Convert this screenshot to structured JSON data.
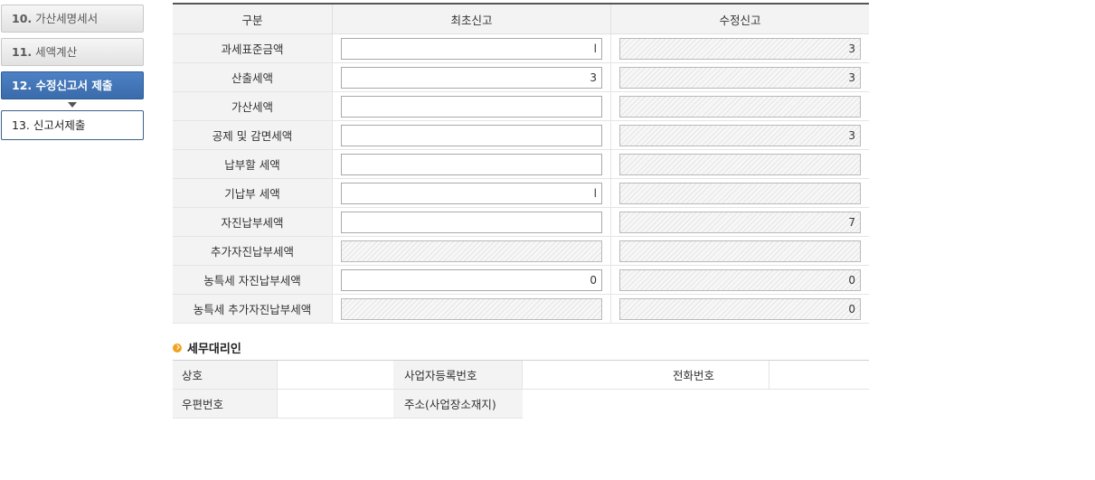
{
  "steps": [
    {
      "num": "10.",
      "label": "가산세명세서"
    },
    {
      "num": "11.",
      "label": "세액계산"
    },
    {
      "num": "12.",
      "label": "수정신고서 제출"
    },
    {
      "num": "13.",
      "label": "신고서제출"
    }
  ],
  "table": {
    "headers": [
      "구분",
      "최초신고",
      "수정신고"
    ],
    "rows": [
      {
        "label": "과세표준금액",
        "initial": "l",
        "amended": "3"
      },
      {
        "label": "산출세액",
        "initial": "3",
        "amended": "3"
      },
      {
        "label": "가산세액",
        "initial": "",
        "amended": ""
      },
      {
        "label": "공제 및 감면세액",
        "initial": "",
        "amended": "3"
      },
      {
        "label": "납부할 세액",
        "initial": "",
        "amended": ""
      },
      {
        "label": "기납부 세액",
        "initial": "l",
        "amended": ""
      },
      {
        "label": "자진납부세액",
        "initial": "",
        "amended": "7"
      },
      {
        "label": "추가자진납부세액",
        "initial": "",
        "amended": ""
      },
      {
        "label": "농특세 자진납부세액",
        "initial": "0",
        "amended": "0"
      },
      {
        "label": "농특세 추가자진납부세액",
        "initial": "",
        "amended": "0"
      }
    ]
  },
  "agent": {
    "title": "세무대리인",
    "labels": {
      "name": "상호",
      "biz_no": "사업자등록번호",
      "phone": "전화번호",
      "zip": "우편번호",
      "address": "주소(사업장소재지)"
    }
  }
}
